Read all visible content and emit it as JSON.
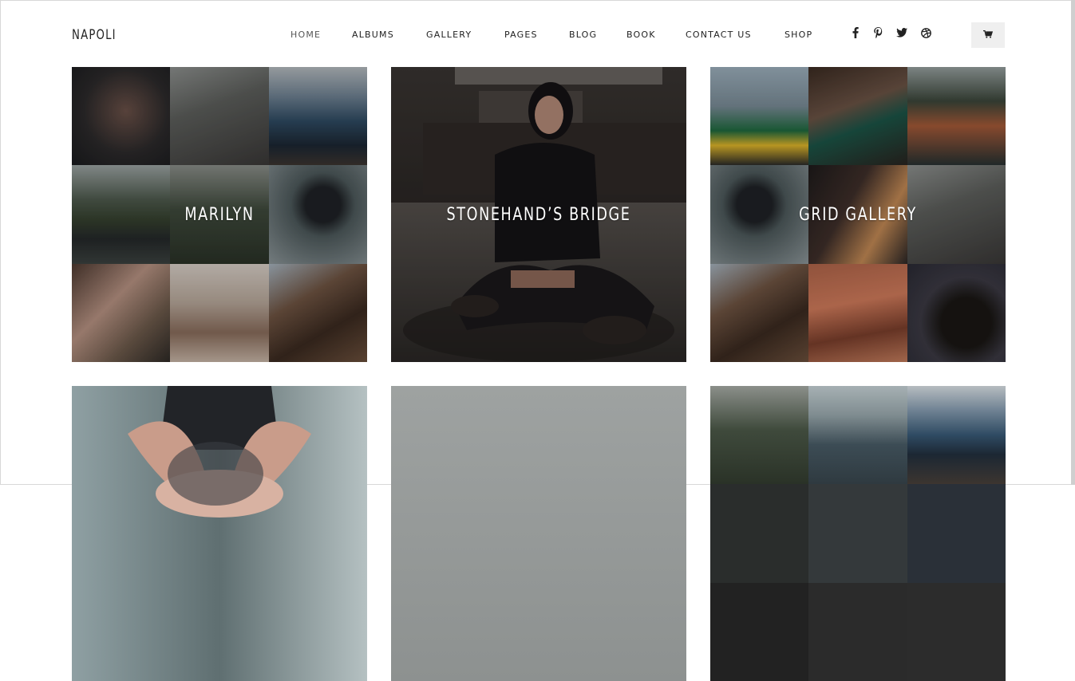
{
  "site": {
    "logo": "NAPOLI"
  },
  "nav": {
    "items": [
      {
        "label": "HOME",
        "active": true
      },
      {
        "label": "ALBUMS",
        "active": false
      },
      {
        "label": "GALLERY",
        "active": false
      },
      {
        "label": "PAGES",
        "active": false
      },
      {
        "label": "BLOG",
        "active": false
      },
      {
        "label": "BOOK",
        "active": false
      },
      {
        "label": "CONTACT US",
        "active": false
      },
      {
        "label": "SHOP",
        "active": false
      }
    ]
  },
  "social": {
    "icons": [
      "facebook-icon",
      "pinterest-icon",
      "twitter-icon",
      "dribbble-icon"
    ]
  },
  "cart": {
    "icon": "cart-icon"
  },
  "albums": [
    {
      "title": "MARILYN"
    },
    {
      "title": "STONEHAND’S BRIDGE"
    },
    {
      "title": "GRID GALLERY"
    },
    {
      "title": ""
    },
    {
      "title": ""
    },
    {
      "title": ""
    }
  ],
  "colors": {
    "text": "#222222",
    "cart_bg": "#efefef",
    "title_text": "#ffffff"
  }
}
